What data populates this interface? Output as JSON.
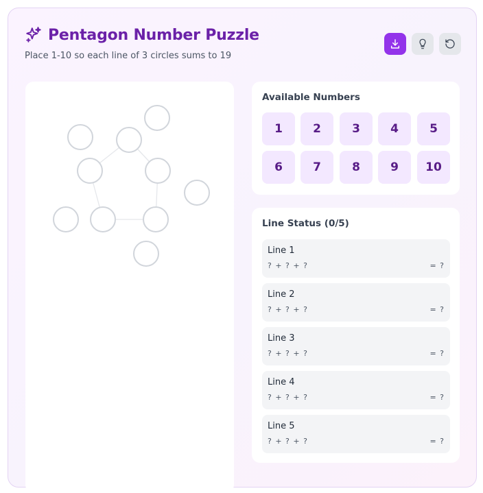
{
  "header": {
    "title": "Pentagon Number Puzzle",
    "subtitle": "Place 1-10 so each line of 3 circles sums to 19",
    "icon": "sparkles-icon"
  },
  "toolbar": {
    "download": {
      "icon": "download-icon",
      "color": "#9333ea"
    },
    "hint": {
      "icon": "lightbulb-icon"
    },
    "reset": {
      "icon": "reset-icon"
    }
  },
  "board": {
    "circle_count": 10,
    "filled": 0
  },
  "available_numbers": {
    "title": "Available Numbers",
    "numbers": [
      "1",
      "2",
      "3",
      "4",
      "5",
      "6",
      "7",
      "8",
      "9",
      "10"
    ]
  },
  "line_status": {
    "title": "Line Status (0/5)",
    "lines": [
      {
        "name": "Line 1",
        "expr": "? + ? + ?",
        "sum": "= ?"
      },
      {
        "name": "Line 2",
        "expr": "? + ? + ?",
        "sum": "= ?"
      },
      {
        "name": "Line 3",
        "expr": "? + ? + ?",
        "sum": "= ?"
      },
      {
        "name": "Line 4",
        "expr": "? + ? + ?",
        "sum": "= ?"
      },
      {
        "name": "Line 5",
        "expr": "? + ? + ?",
        "sum": "= ?"
      }
    ]
  },
  "colors": {
    "accent": "#9333ea",
    "title": "#6b21a8",
    "tile_bg": "#f3e8ff",
    "tile_text": "#581c87"
  }
}
